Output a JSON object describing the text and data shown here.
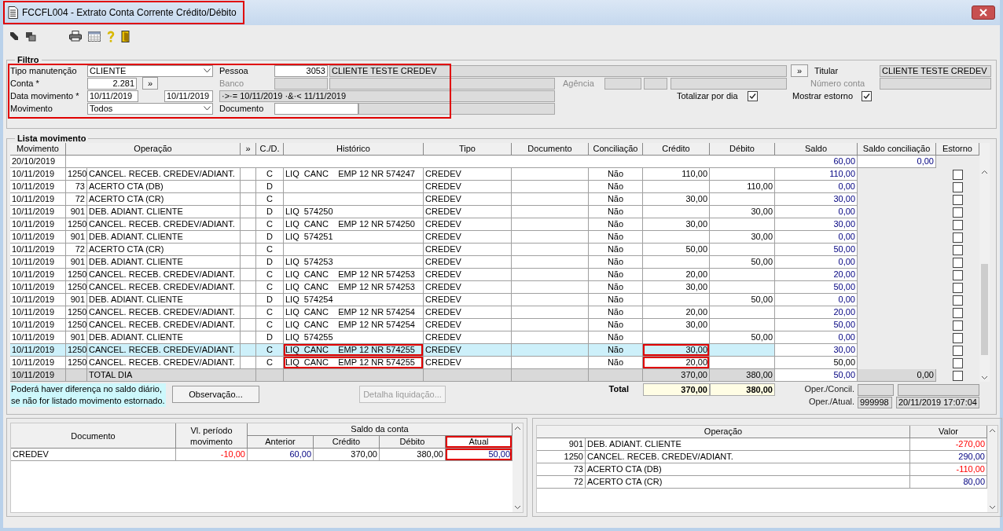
{
  "window": {
    "title": "FCCFL004 - Extrato Conta Corrente Crédito/Débito",
    "marked": true
  },
  "filter": {
    "legend": "Filtro",
    "marked": true,
    "tipo_manutencao": {
      "label": "Tipo manutenção",
      "value": "CLIENTE"
    },
    "pessoa": {
      "label": "Pessoa",
      "code": "3053",
      "name": "CLIENTE TESTE CREDEV",
      "lookup_button": "»"
    },
    "titular": {
      "label": "Titular",
      "value": "CLIENTE TESTE CREDEV"
    },
    "conta": {
      "label": "Conta *",
      "value": "2.281",
      "lookup_button": "»"
    },
    "banco": {
      "label": "Banco",
      "disabled": true
    },
    "agencia": {
      "label": "Agência",
      "disabled": true
    },
    "numero_conta": {
      "label": "Número conta",
      "disabled": true
    },
    "data_movimento": {
      "label": "Data movimento *",
      "from": "10/11/2019",
      "to": "10/11/2019",
      "expression": "·>·= 10/11/2019 ·&·< 11/11/2019"
    },
    "totalizar_por_dia": {
      "label": "Totalizar por dia",
      "checked": true
    },
    "mostrar_estorno": {
      "label": "Mostrar estorno",
      "checked": true
    },
    "movimento": {
      "label": "Movimento",
      "value": "Todos"
    },
    "documento": {
      "label": "Documento"
    }
  },
  "lista": {
    "legend": "Lista movimento",
    "columns": [
      "Movimento",
      "Operação",
      "»",
      "C./D.",
      "Histórico",
      "Tipo",
      "Documento",
      "Conciliação",
      "Crédito",
      "Débito",
      "Saldo",
      "Saldo conciliação",
      "Estorno"
    ],
    "rows": [
      {
        "kind": "opening",
        "date": "20/10/2019",
        "saldo": "60,00",
        "saldo_conciliacao": "0,00"
      },
      {
        "kind": "entry",
        "date": "10/11/2019",
        "code": "1250",
        "operacao": "CANCEL. RECEB. CREDEV/ADIANT.",
        "cd": "C",
        "historico": "LIQ  CANC    EMP 12 NR 574247",
        "tipo": "CREDEV",
        "conciliacao": "Não",
        "credito": "110,00",
        "saldo": "110,00",
        "estorno": false,
        "selected": false,
        "marked": false
      },
      {
        "kind": "entry",
        "date": "10/11/2019",
        "code": "73",
        "operacao": "ACERTO CTA (DB)",
        "cd": "D",
        "tipo": "CREDEV",
        "conciliacao": "Não",
        "debito": "110,00",
        "saldo": "0,00",
        "estorno": false,
        "selected": false,
        "marked": false
      },
      {
        "kind": "entry",
        "date": "10/11/2019",
        "code": "72",
        "operacao": "ACERTO CTA (CR)",
        "cd": "C",
        "tipo": "CREDEV",
        "conciliacao": "Não",
        "credito": "30,00",
        "saldo": "30,00",
        "estorno": false,
        "selected": false,
        "marked": false
      },
      {
        "kind": "entry",
        "date": "10/11/2019",
        "code": "901",
        "operacao": "DEB. ADIANT. CLIENTE",
        "cd": "D",
        "historico": "LIQ  574250",
        "tipo": "CREDEV",
        "conciliacao": "Não",
        "debito": "30,00",
        "saldo": "0,00",
        "estorno": false,
        "selected": false,
        "marked": false
      },
      {
        "kind": "entry",
        "date": "10/11/2019",
        "code": "1250",
        "operacao": "CANCEL. RECEB. CREDEV/ADIANT.",
        "cd": "C",
        "historico": "LIQ  CANC    EMP 12 NR 574250",
        "tipo": "CREDEV",
        "conciliacao": "Não",
        "credito": "30,00",
        "saldo": "30,00",
        "estorno": false,
        "selected": false,
        "marked": false
      },
      {
        "kind": "entry",
        "date": "10/11/2019",
        "code": "901",
        "operacao": "DEB. ADIANT. CLIENTE",
        "cd": "D",
        "historico": "LIQ  574251",
        "tipo": "CREDEV",
        "conciliacao": "Não",
        "debito": "30,00",
        "saldo": "0,00",
        "estorno": false,
        "selected": false,
        "marked": false
      },
      {
        "kind": "entry",
        "date": "10/11/2019",
        "code": "72",
        "operacao": "ACERTO CTA (CR)",
        "cd": "C",
        "tipo": "CREDEV",
        "conciliacao": "Não",
        "credito": "50,00",
        "saldo": "50,00",
        "estorno": false,
        "selected": false,
        "marked": false
      },
      {
        "kind": "entry",
        "date": "10/11/2019",
        "code": "901",
        "operacao": "DEB. ADIANT. CLIENTE",
        "cd": "D",
        "historico": "LIQ  574253",
        "tipo": "CREDEV",
        "conciliacao": "Não",
        "debito": "50,00",
        "saldo": "0,00",
        "estorno": false,
        "selected": false,
        "marked": false
      },
      {
        "kind": "entry",
        "date": "10/11/2019",
        "code": "1250",
        "operacao": "CANCEL. RECEB. CREDEV/ADIANT.",
        "cd": "C",
        "historico": "LIQ  CANC    EMP 12 NR 574253",
        "tipo": "CREDEV",
        "conciliacao": "Não",
        "credito": "20,00",
        "saldo": "20,00",
        "estorno": false,
        "selected": false,
        "marked": false
      },
      {
        "kind": "entry",
        "date": "10/11/2019",
        "code": "1250",
        "operacao": "CANCEL. RECEB. CREDEV/ADIANT.",
        "cd": "C",
        "historico": "LIQ  CANC    EMP 12 NR 574253",
        "tipo": "CREDEV",
        "conciliacao": "Não",
        "credito": "30,00",
        "saldo": "50,00",
        "estorno": false,
        "selected": false,
        "marked": false
      },
      {
        "kind": "entry",
        "date": "10/11/2019",
        "code": "901",
        "operacao": "DEB. ADIANT. CLIENTE",
        "cd": "D",
        "historico": "LIQ  574254",
        "tipo": "CREDEV",
        "conciliacao": "Não",
        "debito": "50,00",
        "saldo": "0,00",
        "estorno": false,
        "selected": false,
        "marked": false
      },
      {
        "kind": "entry",
        "date": "10/11/2019",
        "code": "1250",
        "operacao": "CANCEL. RECEB. CREDEV/ADIANT.",
        "cd": "C",
        "historico": "LIQ  CANC    EMP 12 NR 574254",
        "tipo": "CREDEV",
        "conciliacao": "Não",
        "credito": "20,00",
        "saldo": "20,00",
        "estorno": false,
        "selected": false,
        "marked": false
      },
      {
        "kind": "entry",
        "date": "10/11/2019",
        "code": "1250",
        "operacao": "CANCEL. RECEB. CREDEV/ADIANT.",
        "cd": "C",
        "historico": "LIQ  CANC    EMP 12 NR 574254",
        "tipo": "CREDEV",
        "conciliacao": "Não",
        "credito": "30,00",
        "saldo": "50,00",
        "estorno": false,
        "selected": false,
        "marked": false
      },
      {
        "kind": "entry",
        "date": "10/11/2019",
        "code": "901",
        "operacao": "DEB. ADIANT. CLIENTE",
        "cd": "D",
        "historico": "LIQ  574255",
        "tipo": "CREDEV",
        "conciliacao": "Não",
        "debito": "50,00",
        "saldo": "0,00",
        "estorno": false,
        "selected": false,
        "marked": false
      },
      {
        "kind": "entry",
        "date": "10/11/2019",
        "code": "1250",
        "operacao": "CANCEL. RECEB. CREDEV/ADIANT.",
        "cd": "C",
        "historico": "LIQ  CANC    EMP 12 NR 574255",
        "tipo": "CREDEV",
        "conciliacao": "Não",
        "credito": "30,00",
        "saldo": "30,00",
        "estorno": false,
        "selected": true,
        "marked": true
      },
      {
        "kind": "entry",
        "date": "10/11/2019",
        "code": "1250",
        "operacao": "CANCEL. RECEB. CREDEV/ADIANT.",
        "cd": "C",
        "historico": "LIQ  CANC    EMP 12 NR 574255",
        "tipo": "CREDEV",
        "conciliacao": "Não",
        "credito": "20,00",
        "saldo": "50,00",
        "estorno": false,
        "selected": false,
        "marked": true
      },
      {
        "kind": "total",
        "date": "10/11/2019",
        "operacao": "TOTAL DIA",
        "credito": "370,00",
        "debito": "380,00",
        "saldo": "50,00",
        "saldo_conciliacao": "0,00",
        "estorno": false
      }
    ],
    "note": "Poderá haver diferença no saldo diário, se não for listado movimento estornado.",
    "observacao_button": {
      "label": "Observação...",
      "disabled": false
    },
    "detalha_button": {
      "label": "Detalha liquidação...",
      "disabled": true
    },
    "total": {
      "label": "Total",
      "credito": "370,00",
      "debito": "380,00"
    },
    "oper_concil": {
      "label": "Oper./Concil."
    },
    "oper_atual": {
      "label": "Oper./Atual.",
      "user": "999998",
      "datetime": "20/11/2019 17:07:04"
    }
  },
  "saldo_table": {
    "columns": {
      "documento": "Documento",
      "periodo": "Vl. período movimento",
      "group": "Saldo da conta",
      "anterior": "Anterior",
      "credito": "Crédito",
      "debito": "Débito",
      "atual": "Atual"
    },
    "rows": [
      {
        "documento": "CREDEV",
        "periodo": {
          "text": "-10,00",
          "kind": "negative"
        },
        "anterior": {
          "text": "60,00",
          "kind": "positive"
        },
        "credito": {
          "text": "370,00",
          "kind": "plain"
        },
        "debito": {
          "text": "380,00",
          "kind": "plain"
        },
        "atual": {
          "text": "50,00",
          "kind": "positive"
        },
        "atual_marked": true
      }
    ]
  },
  "operacao_table": {
    "columns": [
      "Operação",
      "Valor"
    ],
    "rows": [
      {
        "code": "901",
        "name": "DEB. ADIANT. CLIENTE",
        "valor": "-270,00",
        "kind": "negative"
      },
      {
        "code": "1250",
        "name": "CANCEL. RECEB. CREDEV/ADIANT.",
        "valor": "290,00",
        "kind": "positive"
      },
      {
        "code": "73",
        "name": "ACERTO CTA (DB)",
        "valor": "-110,00",
        "kind": "negative"
      },
      {
        "code": "72",
        "name": "ACERTO CTA (CR)",
        "valor": "80,00",
        "kind": "positive"
      }
    ]
  }
}
